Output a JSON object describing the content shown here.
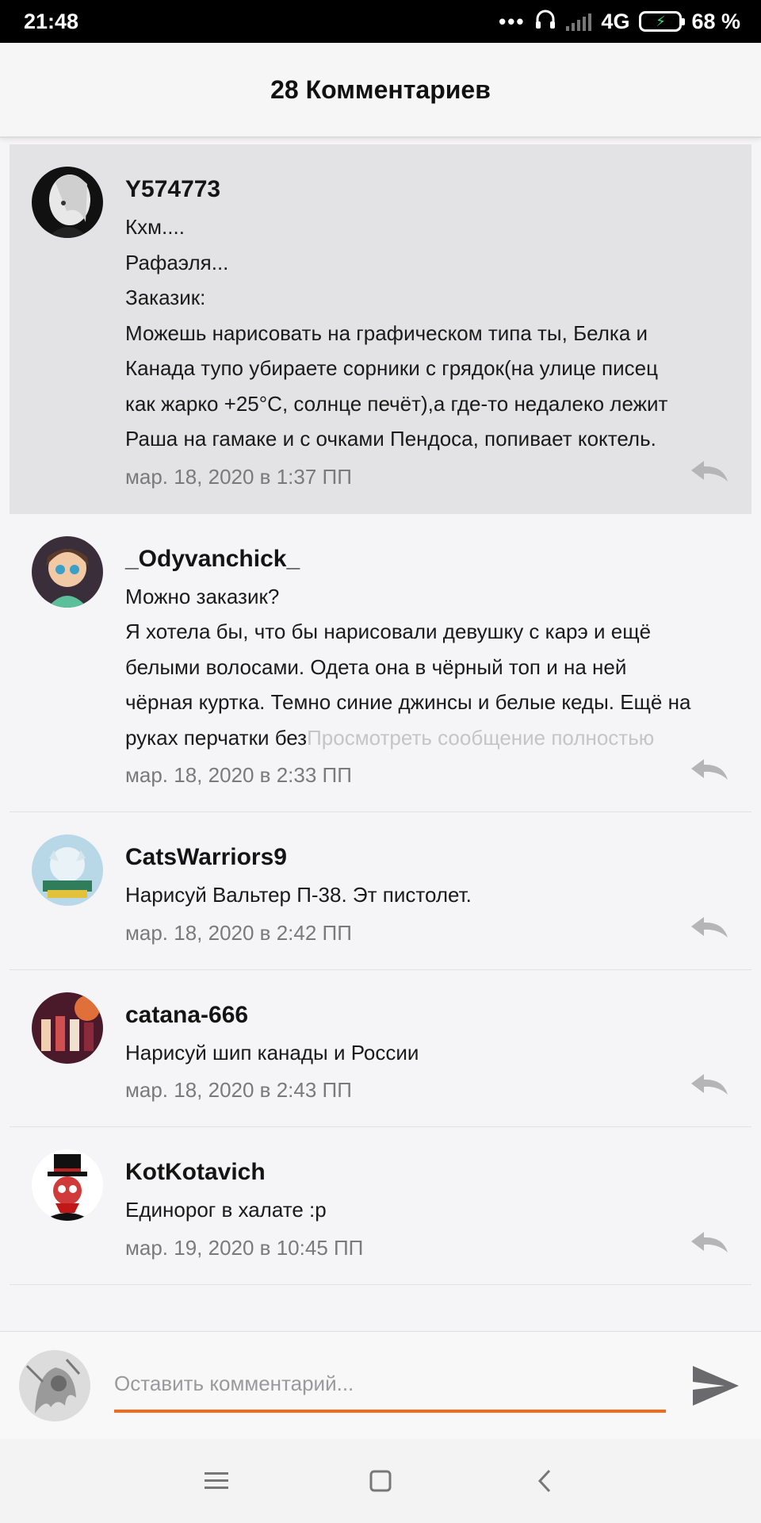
{
  "status_bar": {
    "time": "21:48",
    "dots": "•••",
    "network": "4G",
    "battery": "68 %"
  },
  "header": {
    "title": "28 Комментариев"
  },
  "comments": [
    {
      "author": "Y574773",
      "lines": [
        "Кхм....",
        "Рафаэля...",
        "Заказик:",
        "Можешь нарисовать на графическом типа ты, Белка и",
        "Канада тупо убираете сорники с грядок(на улице писец",
        "как жарко +25°C, солнце печёт),а где-то недалеко лежит",
        "Раша на гамаке и с очками Пендоса, попивает коктель."
      ],
      "date": "мар. 18, 2020 в 1:37 ПП",
      "highlighted": true
    },
    {
      "author": "_Odyvanchick_",
      "lines": [
        "Можно заказик?",
        "Я хотела бы, что бы нарисовали девушку с карэ и ещё",
        "белыми волосами. Одета она в чёрный топ и на ней",
        "чёрная куртка. Темно синие джинсы и белые кеды. Ещё на",
        "руках перчатки без"
      ],
      "more": "Просмотреть сообщение полностью",
      "date": "мар. 18, 2020 в 2:33 ПП"
    },
    {
      "author": "CatsWarriors9",
      "lines": [
        "Нарисуй Вальтер П-38. Эт пистолет."
      ],
      "date": "мар. 18, 2020 в 2:42 ПП"
    },
    {
      "author": "catana-666",
      "lines": [
        "Нарисуй шип канады и России"
      ],
      "date": "мар. 18, 2020 в 2:43 ПП"
    },
    {
      "author": "KotKotavich",
      "lines": [
        "Единорог в халате :p"
      ],
      "date": "мар. 19, 2020 в 10:45 ПП"
    }
  ],
  "composer": {
    "placeholder": "Оставить комментарий..."
  },
  "colors": {
    "accent": "#f26a20",
    "highlight_bg": "#e3e3e5"
  }
}
